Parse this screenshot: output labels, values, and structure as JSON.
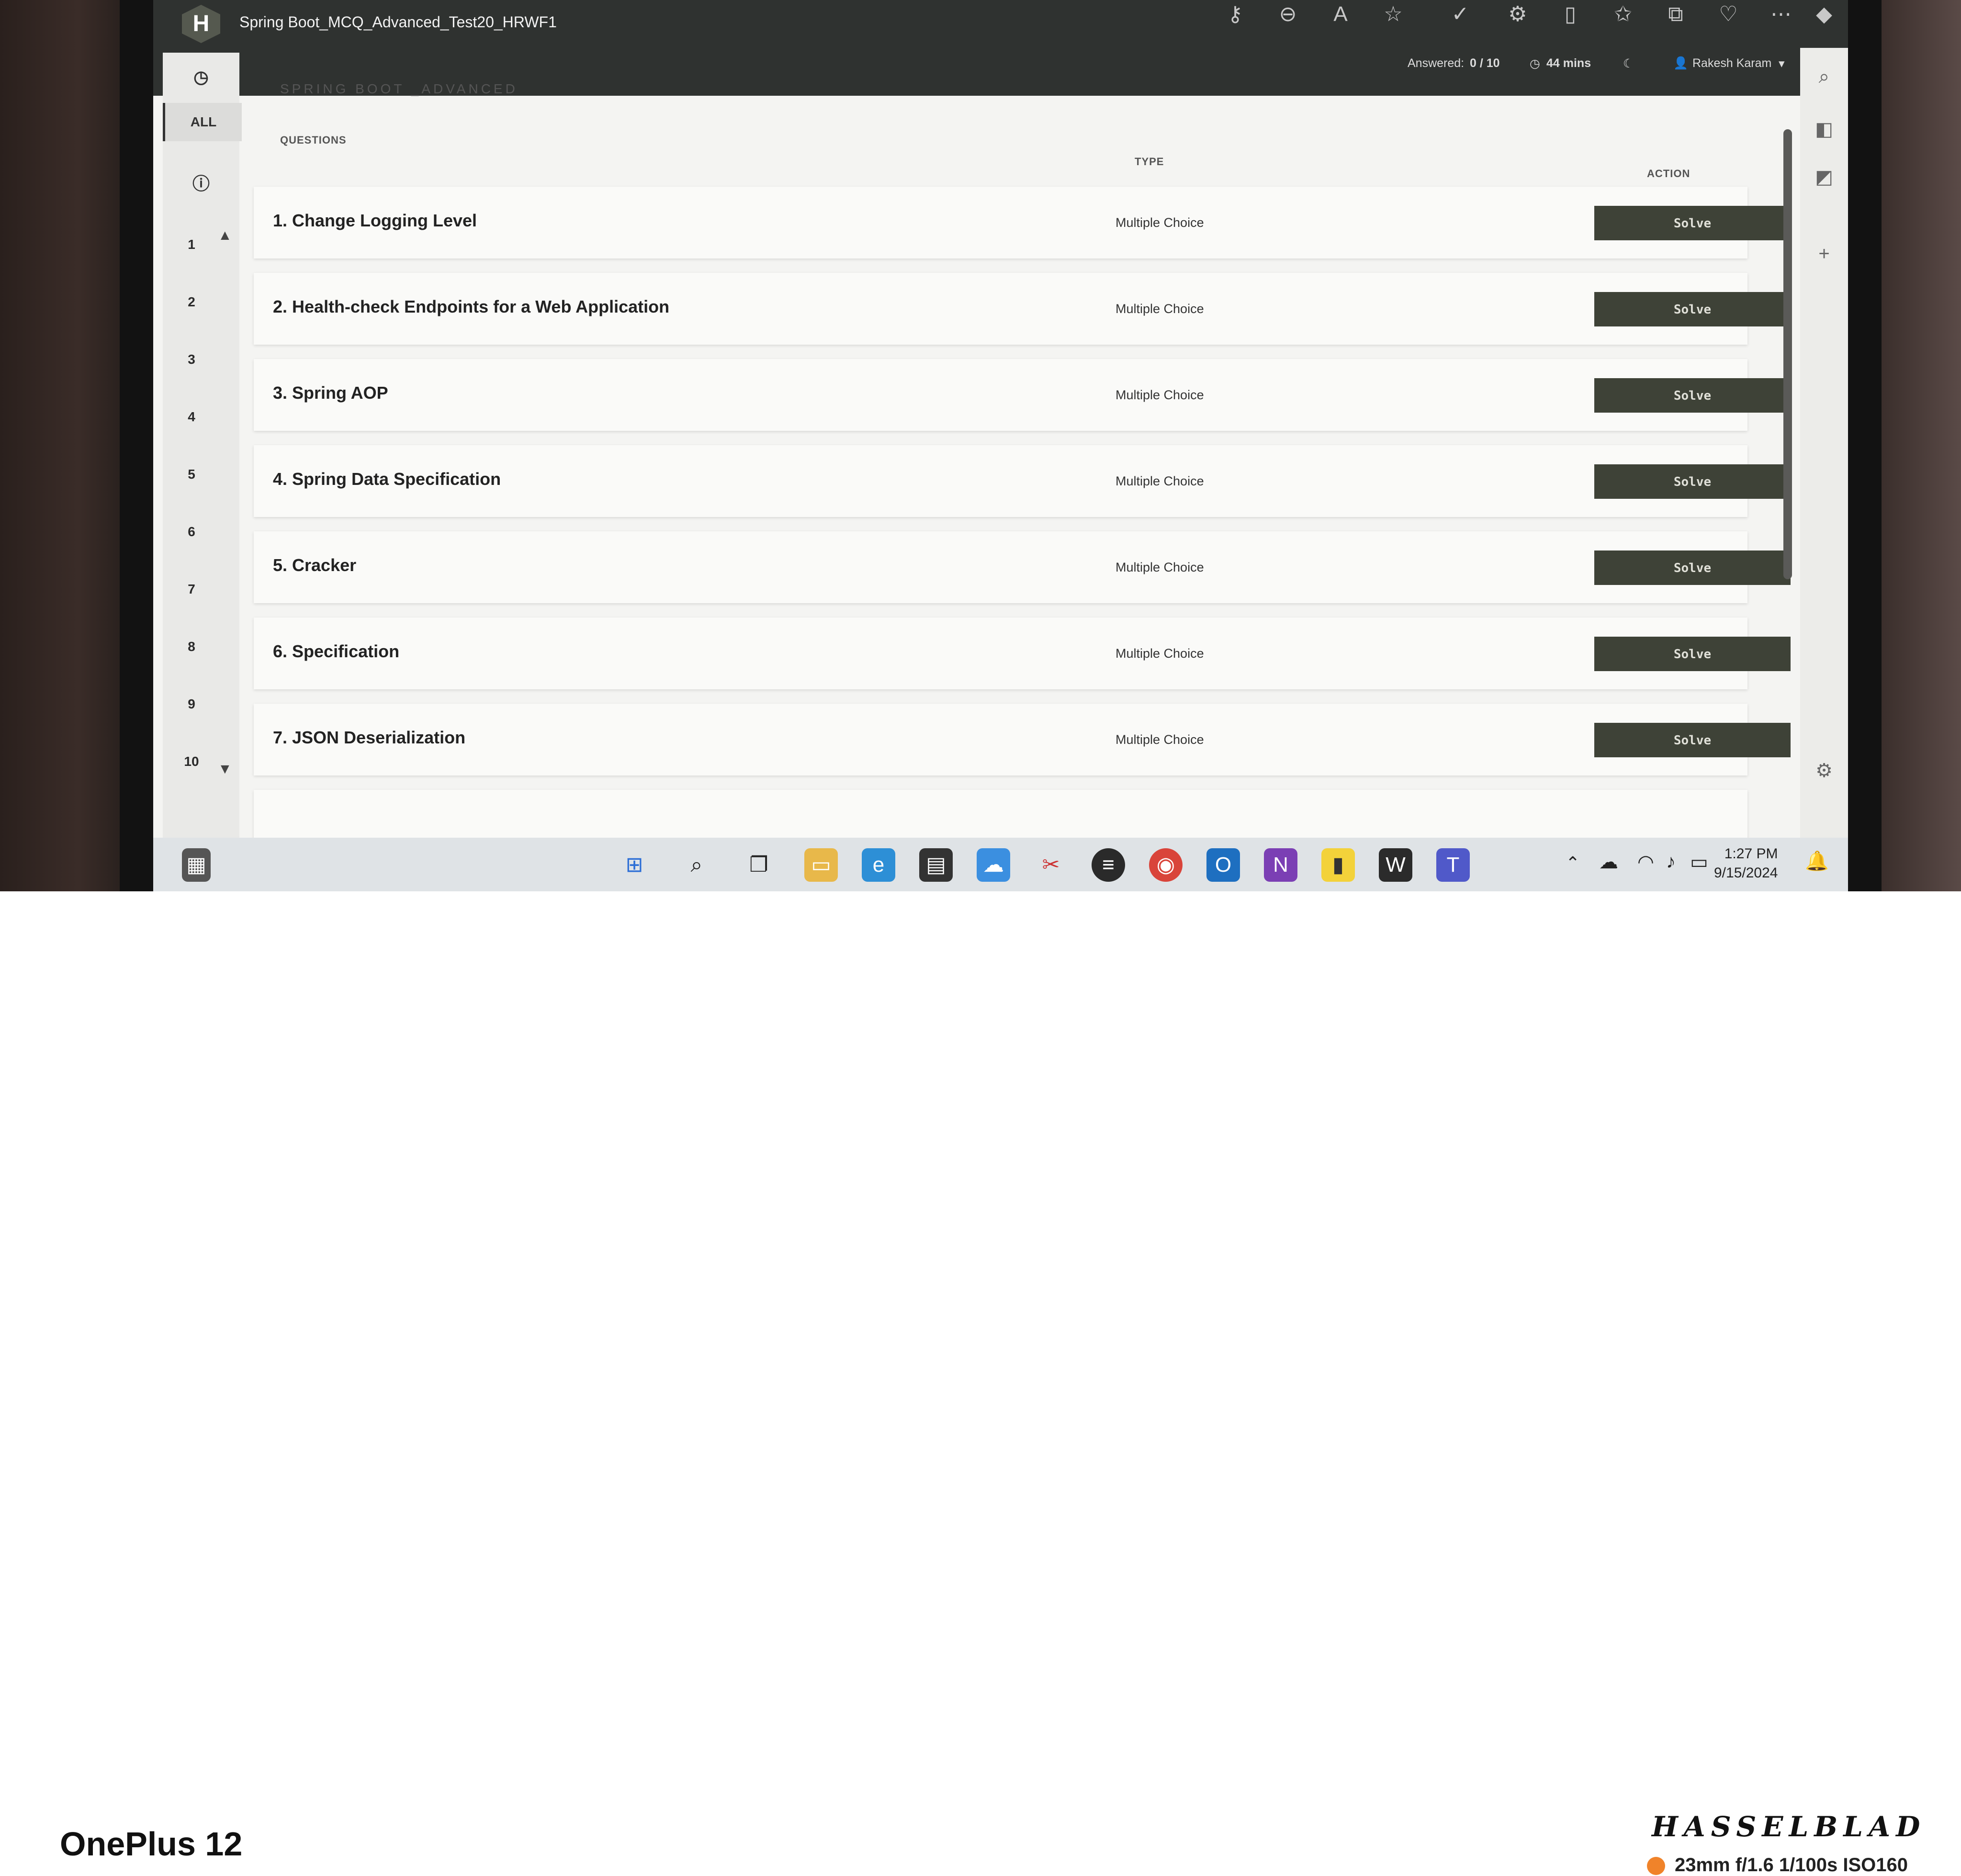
{
  "app": {
    "title": "Spring Boot_MCQ_Advanced_Test20_HRWF1",
    "logo_letter": "H"
  },
  "status": {
    "answered_label": "Answered:",
    "answered_value": "0 / 10",
    "time_left": "44 mins",
    "user_name": "Rakesh Karam"
  },
  "rail": {
    "all_label": "ALL",
    "numbers": [
      "1",
      "2",
      "3",
      "4",
      "5",
      "6",
      "7",
      "8",
      "9",
      "10"
    ]
  },
  "main": {
    "section_title": "SPRING BOOT _ADVANCED",
    "col_questions": "QUESTIONS",
    "col_type": "TYPE",
    "col_action": "ACTION",
    "questions": [
      {
        "title": "1. Change Logging Level",
        "type": "Multiple Choice",
        "action": "Solve"
      },
      {
        "title": "2. Health-check Endpoints for a Web Application",
        "type": "Multiple Choice",
        "action": "Solve"
      },
      {
        "title": "3. Spring AOP",
        "type": "Multiple Choice",
        "action": "Solve"
      },
      {
        "title": "4. Spring Data Specification",
        "type": "Multiple Choice",
        "action": "Solve"
      },
      {
        "title": "5. Cracker",
        "type": "Multiple Choice",
        "action": "Solve"
      },
      {
        "title": "6. Specification",
        "type": "Multiple Choice",
        "action": "Solve"
      },
      {
        "title": "7. JSON Deserialization",
        "type": "Multiple Choice",
        "action": "Solve"
      }
    ]
  },
  "clock": {
    "time": "1:27 PM",
    "date": "9/15/2024"
  },
  "caption": {
    "device": "OnePlus 12",
    "brand": "HASSELBLAD",
    "exif": "23mm  f/1.6  1/100s  ISO160",
    "accent": "#f0832a"
  },
  "icons": {
    "titlebar": [
      "key-icon",
      "zoom-out-icon",
      "read-aloud-icon",
      "favorite-star-icon",
      "checkmark-icon",
      "extensions-icon",
      "split-screen-icon",
      "favorites-icon",
      "collections-icon",
      "performance-icon",
      "more-icon",
      "copilot-icon"
    ],
    "taskbar": [
      "windows-start-icon",
      "search-icon",
      "task-view-icon",
      "file-explorer-icon",
      "edge-icon",
      "store-icon",
      "onedrive-icon",
      "snipping-tool-icon",
      "eclipse-icon",
      "chrome-icon",
      "outlook-icon",
      "onenote-icon",
      "sticky-notes-icon",
      "vscode-icon",
      "teams-icon"
    ]
  }
}
